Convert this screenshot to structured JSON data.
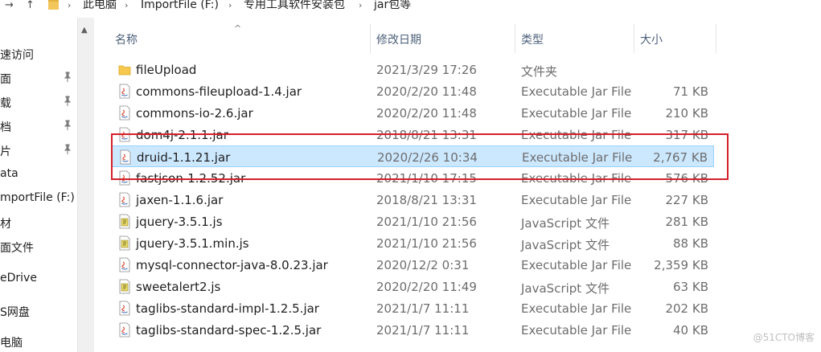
{
  "address_bar": {
    "crumbs": [
      "此电脑",
      "ImportFile (F:)",
      "专用工具软件安装包",
      "jar包等"
    ]
  },
  "nav": {
    "items": [
      "速访问",
      "面",
      "载",
      "档",
      "片",
      "ata",
      "mportFile (F:)",
      "材",
      "面文件",
      "eDrive",
      "S网盘",
      "电脑"
    ]
  },
  "columns": {
    "name": "名称",
    "date": "修改日期",
    "type": "类型",
    "size": "大小"
  },
  "files": [
    {
      "name": "fileUpload",
      "date": "2021/3/29 17:26",
      "type": "文件夹",
      "size": "",
      "icon": "folder-icon"
    },
    {
      "name": "commons-fileupload-1.4.jar",
      "date": "2020/2/20 11:48",
      "type": "Executable Jar File",
      "size": "71 KB",
      "icon": "jar-file-icon"
    },
    {
      "name": "commons-io-2.6.jar",
      "date": "2020/2/20 11:48",
      "type": "Executable Jar File",
      "size": "210 KB",
      "icon": "jar-file-icon"
    },
    {
      "name": "dom4j-2.1.1.jar",
      "date": "2018/8/21 13:31",
      "type": "Executable Jar File",
      "size": "317 KB",
      "icon": "jar-file-icon"
    },
    {
      "name": "druid-1.1.21.jar",
      "date": "2020/2/26 10:34",
      "type": "Executable Jar File",
      "size": "2,767 KB",
      "icon": "jar-file-icon"
    },
    {
      "name": "fastjson-1.2.52.jar",
      "date": "2021/1/10 17:15",
      "type": "Executable Jar File",
      "size": "576 KB",
      "icon": "jar-file-icon"
    },
    {
      "name": "jaxen-1.1.6.jar",
      "date": "2018/8/21 13:31",
      "type": "Executable Jar File",
      "size": "227 KB",
      "icon": "jar-file-icon"
    },
    {
      "name": "jquery-3.5.1.js",
      "date": "2021/1/10 21:56",
      "type": "JavaScript 文件",
      "size": "281 KB",
      "icon": "js-file-icon"
    },
    {
      "name": "jquery-3.5.1.min.js",
      "date": "2021/1/10 21:56",
      "type": "JavaScript 文件",
      "size": "88 KB",
      "icon": "js-file-icon"
    },
    {
      "name": "mysql-connector-java-8.0.23.jar",
      "date": "2020/12/2 0:31",
      "type": "Executable Jar File",
      "size": "2,359 KB",
      "icon": "jar-file-icon"
    },
    {
      "name": "sweetalert2.js",
      "date": "2020/2/20 11:49",
      "type": "JavaScript 文件",
      "size": "63 KB",
      "icon": "js-file-icon"
    },
    {
      "name": "taglibs-standard-impl-1.2.5.jar",
      "date": "2021/1/7 11:11",
      "type": "Executable Jar File",
      "size": "202 KB",
      "icon": "jar-file-icon"
    },
    {
      "name": "taglibs-standard-spec-1.2.5.jar",
      "date": "2021/1/7 11:11",
      "type": "Executable Jar File",
      "size": "40 KB",
      "icon": "jar-file-icon"
    }
  ],
  "watermark": "@51CTO博客",
  "colors": {
    "selection_bg": "#cce8ff",
    "highlight_box": "#d4202a"
  }
}
